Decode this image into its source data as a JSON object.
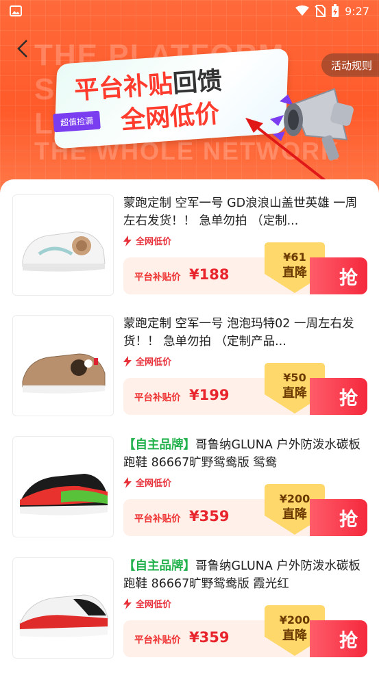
{
  "status_bar": {
    "time": "9:27"
  },
  "header": {
    "rules_button": "活动规则",
    "hero_title_red": "平台补贴",
    "hero_title_dark": "回馈",
    "hero_subtitle": "全网低价",
    "hero_tag": "超值捡漏",
    "bg_text_1": "THE PLATFORM",
    "bg_text_2": "S       THE",
    "bg_text_3": "L",
    "bg_text_4": "THE WHOLE NETWORK"
  },
  "products": [
    {
      "brand": "",
      "title": "蒙跑定制 空军一号 GD浪浪山盖世英雄 一周左右发货！！ 急单勿拍 （定制...",
      "tag": "全网低价",
      "subsidy_label": "平台补贴价",
      "price": "¥188",
      "discount_amount": "¥61",
      "discount_label": "直降",
      "buy_label": "抢",
      "image": "custom-sneaker-white-wukong"
    },
    {
      "brand": "",
      "title": "蒙跑定制 空军一号 泡泡玛特02 一周左右发货！！ 急单勿拍 （定制产品...",
      "tag": "全网低价",
      "subsidy_label": "平台补贴价",
      "price": "¥199",
      "discount_amount": "¥50",
      "discount_label": "直降",
      "buy_label": "抢",
      "image": "custom-sneaker-brown-popmart"
    },
    {
      "brand": "【自主品牌】",
      "title": "哥鲁纳GLUNA 户外防泼水碳板跑鞋 86667旷野鸳鸯版 鸳鸯",
      "tag": "全网低价",
      "subsidy_label": "平台补贴价",
      "price": "¥359",
      "discount_amount": "¥200",
      "discount_label": "直降",
      "buy_label": "抢",
      "image": "running-shoe-red-green"
    },
    {
      "brand": "【自主品牌】",
      "title": "哥鲁纳GLUNA 户外防泼水碳板跑鞋 86667旷野鸳鸯版 霞光红",
      "tag": "全网低价",
      "subsidy_label": "平台补贴价",
      "price": "¥359",
      "discount_amount": "¥200",
      "discount_label": "直降",
      "buy_label": "抢",
      "image": "running-shoe-red-white"
    }
  ],
  "colors": {
    "accent": "#ff5a2a",
    "price": "#e8242c",
    "brand_green": "#22b14c"
  }
}
